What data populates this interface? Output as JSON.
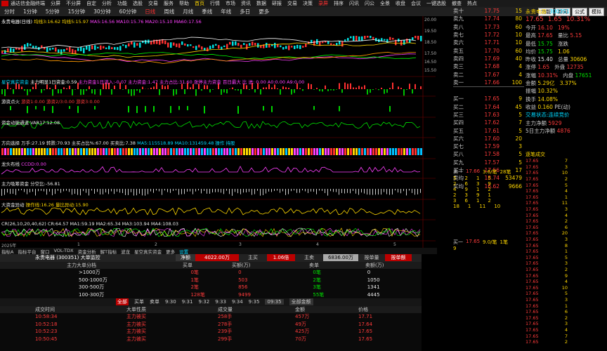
{
  "titlebar": {
    "title": "通达信金融终端",
    "menus": [
      "分屏",
      "不分屏",
      "自定",
      "分析",
      "功能",
      "选股",
      "交易",
      "服务",
      "帮助"
    ]
  },
  "tabs": [
    "分时",
    "1分钟",
    "5分钟",
    "15分钟",
    "30分钟",
    "60分钟",
    "日线",
    "周线",
    "月线",
    "季线",
    "年线",
    "多日",
    "更多"
  ],
  "nav": [
    "首页",
    "行情",
    "市场",
    "资讯",
    "数据",
    "研报",
    "交易",
    "决策",
    "录屏",
    "排序",
    "闪讯",
    "闪公",
    "全景",
    "收盘",
    "会议",
    "一键选股",
    "撤查",
    "热点"
  ],
  "right_buttons": [
    "功能",
    "新闻",
    "公式",
    "模拟"
  ],
  "stock": {
    "name": "永贵电器",
    "code": "300351",
    "price": "17.65",
    "change": "1.65",
    "pct": "10.31%"
  },
  "panels": [
    {
      "label": "永贵电器(日线)",
      "extra": "均线3:16.62  均线5:15.97",
      "detail": "MA5:16.56  MA10:15.76  MA20:15.10  MA60:17.56"
    },
    {
      "label": "星空真实资金",
      "extra": "主力明显1日资金:0.59",
      "detail": "主力资金1日流入:-0.07  主力资金:1.47  主力占比:31.60  涨停主力资金  百日最大  比  进: 0.00  A0:0.00  A9:0.00"
    },
    {
      "label": "游资点火",
      "extra": "游资1:0.00  游资2/3:0.00  游资3:0.00",
      "detail": ""
    },
    {
      "label": "资金动能通道",
      "extra": "VAR17:12.08",
      "detail": ""
    },
    {
      "label": "方向选择",
      "extra": "万手:27.19  转跌:70.93  主买占比%:67.00  买卖比:7.38",
      "detail": "MA5:115518.89  MA10:131459.48  操作  持股"
    },
    {
      "label": "龙头布线",
      "extra": "CCDD:0.00",
      "detail": ""
    },
    {
      "label": "主力吸筹资金",
      "extra": "分空比:-56.81",
      "detail": ""
    },
    {
      "label": "大资金异动",
      "extra": "操作线:16.26  量比异动:15.90",
      "detail": ""
    },
    {
      "label": "CR(26,10,20,40,62)",
      "extra": "CR:64.57  MA1:59.19  MA2:65.34  MA3:103.94  MA4:108.03",
      "detail": ""
    }
  ],
  "price_axis": [
    "20.00",
    "19.50",
    "18.50",
    "17.50",
    "16.50",
    "15.50"
  ],
  "date_axis": [
    "2025年",
    "1",
    "2",
    "3",
    "4",
    "5"
  ],
  "bottom_tabs": [
    "指标A",
    "指标平台",
    "窗口",
    "VOL-TDX",
    "资金分析",
    "解T指标",
    "波龙",
    "星空真实资金",
    "更多",
    "设置"
  ],
  "order_book": {
    "sell": [
      {
        "label": "卖十",
        "price": "17.75",
        "vol": "15"
      },
      {
        "label": "卖九",
        "price": "17.74",
        "vol": "80"
      },
      {
        "label": "卖八",
        "price": "17.73",
        "vol": "60"
      },
      {
        "label": "卖七",
        "price": "17.72",
        "vol": "10"
      },
      {
        "label": "卖六",
        "price": "17.71",
        "vol": "10"
      },
      {
        "label": "卖五",
        "price": "17.70",
        "vol": "60"
      },
      {
        "label": "卖四",
        "price": "17.69",
        "vol": "40"
      },
      {
        "label": "卖三",
        "price": "17.68",
        "vol": "4"
      },
      {
        "label": "卖二",
        "price": "17.67",
        "vol": "4"
      },
      {
        "label": "卖一",
        "price": "17.66",
        "vol": "100"
      }
    ],
    "buy": [
      {
        "label": "买一",
        "price": "17.65",
        "vol": "9"
      },
      {
        "label": "买二",
        "price": "17.64",
        "vol": "45"
      },
      {
        "label": "买三",
        "price": "17.63",
        "vol": "5"
      },
      {
        "label": "买四",
        "price": "17.62",
        "vol": "7"
      },
      {
        "label": "买五",
        "price": "17.61",
        "vol": "5"
      },
      {
        "label": "买六",
        "price": "17.60",
        "vol": "20"
      },
      {
        "label": "买七",
        "price": "17.59",
        "vol": "3"
      },
      {
        "label": "买八",
        "price": "17.58",
        "vol": "5"
      },
      {
        "label": "买九",
        "price": "17.57",
        "vol": "5"
      },
      {
        "label": "买十",
        "price": "17.56",
        "vol": "17"
      }
    ],
    "avg_sell": {
      "label": "卖均",
      "price": "18.74",
      "vol": "53479"
    },
    "avg_buy": {
      "label": "买均",
      "price": "16.62",
      "vol": "9666"
    }
  },
  "info": {
    "today_open": "16.10",
    "open_pct": "19%",
    "high": "17.65",
    "vol_ratio": "5.15",
    "low": "15.75",
    "change_label": "涨跌",
    "amount_low": "15.75",
    "amount_ratio": "1.06",
    "prev": "15.40",
    "shares": "30606",
    "rise": "1.65",
    "inside": "12735",
    "pct": "10.31%",
    "outside": "17651",
    "total_amt": "5.29亿",
    "turnover": "3.37%",
    "circ": "10.32%",
    "float_rate": "14.08%",
    "pe": "0.160",
    "earn": "PE(动)",
    "status": "交易状态:连续竞价",
    "main_net1": "主力净额",
    "main_net1_val": "5929",
    "main_net5": "5日主力净额",
    "main_net5_val": "4876"
  },
  "ticks_header": "逐笔成交",
  "ticks": [
    {
      "t": "17.65",
      "v": "7"
    },
    {
      "t": "17.65",
      "v": "3"
    },
    {
      "t": "17.65",
      "v": "10"
    },
    {
      "t": "17.65",
      "v": "2"
    },
    {
      "t": "17.65",
      "v": "5"
    },
    {
      "t": "17.65",
      "v": "4"
    },
    {
      "t": "17.65",
      "v": "1"
    },
    {
      "t": "17.65",
      "v": "11"
    },
    {
      "t": "17.65",
      "v": "3"
    },
    {
      "t": "17.65",
      "v": "4"
    },
    {
      "t": "17.65",
      "v": "2"
    },
    {
      "t": "17.65",
      "v": "6"
    },
    {
      "t": "17.65",
      "v": "20"
    },
    {
      "t": "17.65",
      "v": "3"
    },
    {
      "t": "17.65",
      "v": "8"
    },
    {
      "t": "17.65",
      "v": "1"
    },
    {
      "t": "17.65",
      "v": "5"
    },
    {
      "t": "17.65",
      "v": "3"
    },
    {
      "t": "17.65",
      "v": "2"
    },
    {
      "t": "17.65",
      "v": "9"
    },
    {
      "t": "17.65",
      "v": "4"
    },
    {
      "t": "17.65",
      "v": "10"
    },
    {
      "t": "17.65",
      "v": "5"
    },
    {
      "t": "17.65",
      "v": "3"
    },
    {
      "t": "17.65",
      "v": "1"
    },
    {
      "t": "17.65",
      "v": "6"
    },
    {
      "t": "17.65",
      "v": "2"
    },
    {
      "t": "17.65",
      "v": "3"
    },
    {
      "t": "17.65",
      "v": "4"
    },
    {
      "t": "17.65",
      "v": "7"
    },
    {
      "t": "17.65",
      "v": "2"
    }
  ],
  "depth": {
    "sell_label": "卖一",
    "sell_price": "17.66",
    "sell_qty": "3.6/笔",
    "sell_cnt": "28笔",
    "buy_label": "买一",
    "buy_price": "17.65",
    "buy_qty": "9.0/笔",
    "buy_cnt": "1笔",
    "rows": [
      {
        "a": "5",
        "b": "2",
        "c": "1",
        "d": "5"
      },
      {
        "a": "2",
        "b": "6",
        "c": "3",
        "d": "9"
      },
      {
        "a": "4",
        "b": "9",
        "c": "1",
        "d": "2"
      },
      {
        "a": "2",
        "b": "3",
        "c": "9",
        "d": "1"
      },
      {
        "a": "3",
        "b": "6",
        "c": "1",
        "d": "2"
      },
      {
        "a": "18",
        "b": "1",
        "c": "11",
        "d": "10"
      }
    ],
    "buy_num": "9"
  },
  "bottom": {
    "title": "永贵电器 (300351) 大单监控",
    "net_label": "净额",
    "net_val": "4022.00万",
    "main_buy": "主买",
    "ratio": "1.06倍",
    "main_sell": "主卖",
    "sell_val": "6836.00万",
    "tab_buy": "按单量",
    "tab_sell": "按单额",
    "head": [
      "主力大单分档",
      "买单",
      "买额(万)",
      "卖单",
      "卖额(万)"
    ],
    "rows": [
      {
        "a": ">1000万",
        "b": "0笔",
        "c": "0",
        "d": "0笔",
        "e": "0"
      },
      {
        "a": "500-1000万",
        "b": "1笔",
        "c": "503",
        "d": "2笔",
        "e": "1050"
      },
      {
        "a": "300-500万",
        "b": "2笔",
        "c": "856",
        "d": "3笔",
        "e": "1341"
      },
      {
        "a": "100-300万",
        "b": "128笔",
        "c": "9499",
        "d": "55笔",
        "e": "4445"
      }
    ],
    "filters": [
      "全部",
      "买单",
      "卖单",
      "9:30",
      "9:31",
      "9:32",
      "9:33",
      "9:34",
      "9:35",
      "09:35",
      "全部金额"
    ],
    "tx_head": [
      "成交时间",
      "大单性质",
      "成交量",
      "金额",
      "价格"
    ],
    "tx": [
      {
        "t": "10:58:34",
        "k": "主力被买",
        "v": "258手",
        "m": "457万",
        "p": "17.71"
      },
      {
        "t": "10:52:18",
        "k": "主力被买",
        "v": "278手",
        "m": "49万",
        "p": "17.64"
      },
      {
        "t": "10:52:23",
        "k": "主力被买",
        "v": "239手",
        "m": "425万",
        "p": "17.65"
      },
      {
        "t": "10:50:45",
        "k": "主力被买",
        "v": "299手",
        "m": "70万",
        "p": "17.65"
      }
    ]
  }
}
